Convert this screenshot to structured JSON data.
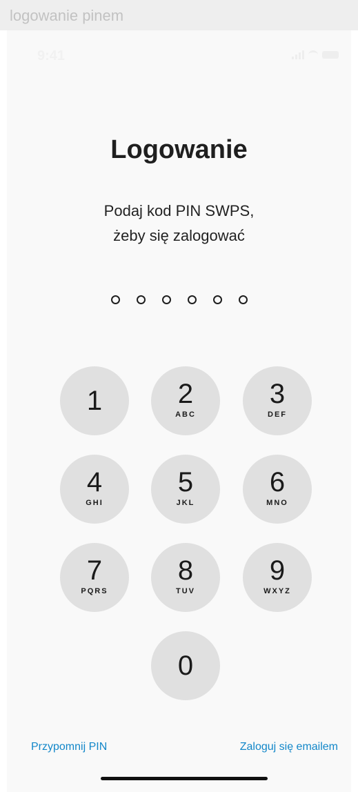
{
  "window": {
    "caption": "logowanie pinem"
  },
  "status_bar": {
    "time": "9:41"
  },
  "screen": {
    "title": "Logowanie",
    "subtitle_line1": "Podaj kod PIN SWPS,",
    "subtitle_line2": "żeby się zalogować"
  },
  "pin": {
    "length": 6,
    "entered": 0
  },
  "keypad": {
    "keys": [
      {
        "digit": "1",
        "letters": ""
      },
      {
        "digit": "2",
        "letters": "ABC"
      },
      {
        "digit": "3",
        "letters": "DEF"
      },
      {
        "digit": "4",
        "letters": "GHI"
      },
      {
        "digit": "5",
        "letters": "JKL"
      },
      {
        "digit": "6",
        "letters": "MNO"
      },
      {
        "digit": "7",
        "letters": "PQRS"
      },
      {
        "digit": "8",
        "letters": "TUV"
      },
      {
        "digit": "9",
        "letters": "WXYZ"
      },
      {
        "digit": "0",
        "letters": ""
      }
    ]
  },
  "footer": {
    "remind_pin": "Przypomnij PIN",
    "login_email": "Zaloguj się emailem"
  },
  "colors": {
    "link": "#1287c9",
    "key_background": "#e0e0e0",
    "text": "#1f1f1f"
  }
}
